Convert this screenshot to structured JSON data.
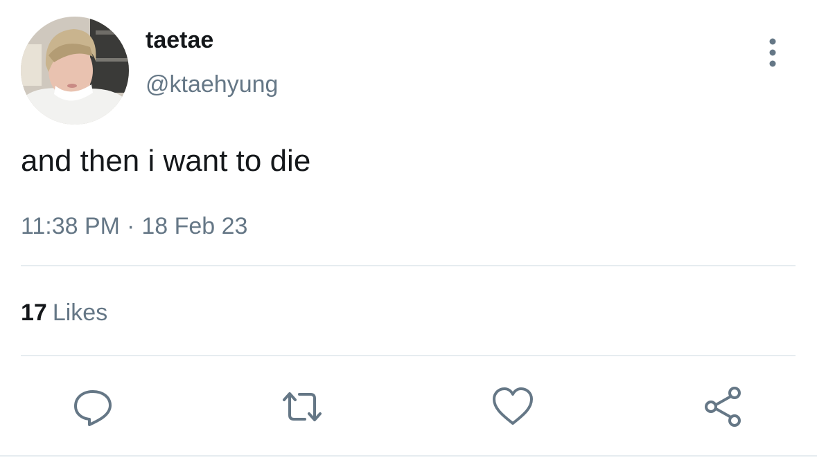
{
  "author": {
    "display_name": "taetae",
    "handle": "@ktaehyung",
    "avatar_icon": "profile-photo"
  },
  "tweet": {
    "text": "and then i want to die",
    "time": "11:38 PM",
    "separator": "·",
    "date": "18 Feb 23"
  },
  "stats": {
    "likes_count": "17",
    "likes_label": "Likes"
  },
  "actions": [
    {
      "name": "reply",
      "icon": "speech-bubble-icon"
    },
    {
      "name": "retweet",
      "icon": "retweet-arrows-icon"
    },
    {
      "name": "like",
      "icon": "heart-icon"
    },
    {
      "name": "share",
      "icon": "share-nodes-icon"
    }
  ],
  "colors": {
    "text_primary": "#14171a",
    "text_secondary": "#657786",
    "icon": "#657786",
    "divider": "#e6ecf0",
    "background": "#ffffff"
  }
}
